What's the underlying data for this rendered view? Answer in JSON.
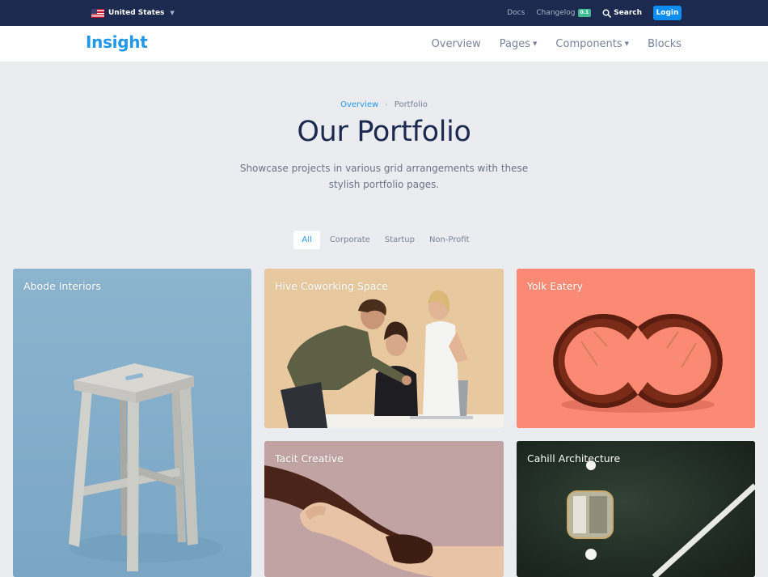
{
  "topbar": {
    "country": "United States",
    "links": {
      "docs": "Docs",
      "changelog": "Changelog",
      "changelog_badge": "0.1",
      "search": "Search"
    },
    "login_label": "Login"
  },
  "navbar": {
    "brand": "Insight",
    "items": [
      {
        "label": "Overview",
        "dropdown": false
      },
      {
        "label": "Pages",
        "dropdown": true
      },
      {
        "label": "Components",
        "dropdown": true
      },
      {
        "label": "Blocks",
        "dropdown": false
      }
    ]
  },
  "hero": {
    "breadcrumb": {
      "parent": "Overview",
      "current": "Portfolio"
    },
    "title": "Our Portfolio",
    "lead": "Showcase projects in various grid arrangements with these stylish portfolio pages."
  },
  "filters": [
    "All",
    "Corporate",
    "Startup",
    "Non-Profit"
  ],
  "active_filter": "All",
  "cards": [
    {
      "title": "Abode Interiors"
    },
    {
      "title": "Hive Coworking Space"
    },
    {
      "title": "Yolk Eatery"
    },
    {
      "title": "Tacit Creative"
    },
    {
      "title": "Cahill Architecture"
    }
  ],
  "icons": {
    "flag": "us-flag-icon",
    "search": "search-icon",
    "caret": "caret-down-icon",
    "breadcrumb_separator": "chevron-right-icon"
  },
  "colors": {
    "topbar_bg": "#1b2a4e",
    "accent": "#2197e8",
    "login_bg": "#0d8ef0",
    "badge": "#42ba96",
    "page_bg": "#eaecef",
    "heading": "#1b2a4e"
  }
}
